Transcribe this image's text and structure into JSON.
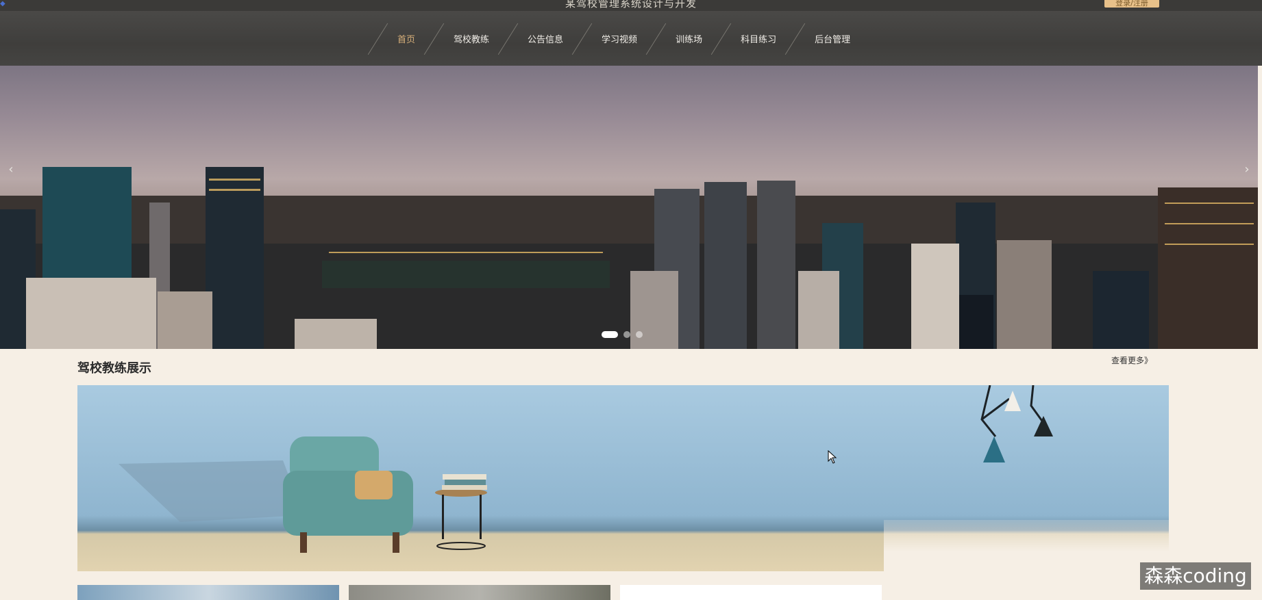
{
  "header": {
    "title": "某驾校管理系统设计与开发",
    "login_label": "登录/注册"
  },
  "nav": {
    "items": [
      {
        "label": "首页",
        "active": true
      },
      {
        "label": "驾校教练"
      },
      {
        "label": "公告信息"
      },
      {
        "label": "学习视频"
      },
      {
        "label": "训练场"
      },
      {
        "label": "科目练习"
      },
      {
        "label": "后台管理"
      }
    ]
  },
  "carousel": {
    "prev_icon": "chevron-left-icon",
    "next_icon": "chevron-right-icon",
    "prev_glyph": "‹",
    "next_glyph": "›",
    "slide_count": 3,
    "active_index": 0
  },
  "section": {
    "title": "驾校教练展示",
    "more_label": "查看更多》"
  },
  "watermark": "森森coding",
  "colors": {
    "background": "#f6efe5",
    "nav_bg": "#474644",
    "active_nav": "#d8b07a",
    "login_button": "#e8c18a"
  }
}
